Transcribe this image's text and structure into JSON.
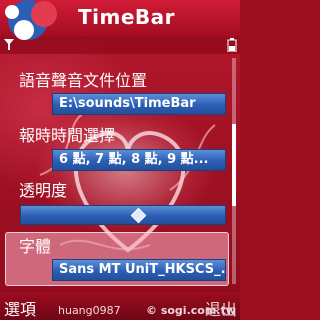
{
  "app": {
    "title": "TimeBar"
  },
  "settings": [
    {
      "label": "語音聲音文件位置",
      "value": "E:\\sounds\\TimeBar"
    },
    {
      "label": "報時時間選擇",
      "value": "6 點, 7 點, 8 點, 9 點..."
    },
    {
      "label": "透明度",
      "slider_level": 0.55
    },
    {
      "label": "字體",
      "value": "Sans MT  UniT_HKSCS_..."
    }
  ],
  "softkeys": {
    "left": "選項",
    "right": "退出"
  },
  "watermark": {
    "user": "huang0987",
    "site": "© sogi.com.tw"
  },
  "colors": {
    "field_blue": "#2b5fb4",
    "header_red": "#d11c36",
    "background_red": "#9b0f1f"
  },
  "icons": [
    "signal-icon",
    "battery-icon",
    "app-logo-icon",
    "slider-knob-icon"
  ]
}
